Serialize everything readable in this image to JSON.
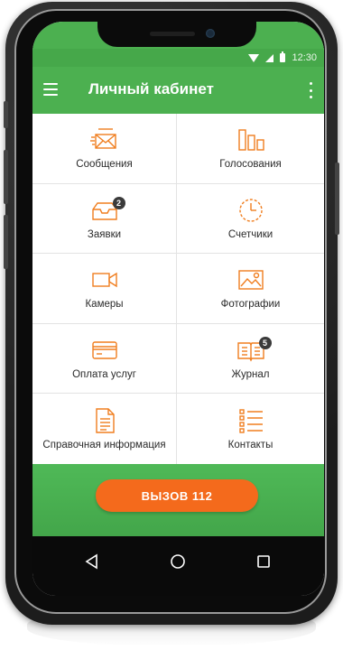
{
  "status_bar": {
    "time": "12:30"
  },
  "app_bar": {
    "title": "Личный кабинет"
  },
  "tiles": [
    {
      "label": "Сообщения",
      "icon": "envelope-icon"
    },
    {
      "label": "Голосования",
      "icon": "bar-chart-icon"
    },
    {
      "label": "Заявки",
      "icon": "inbox-tray-icon",
      "badge": "2"
    },
    {
      "label": "Счетчики",
      "icon": "meter-clock-icon"
    },
    {
      "label": "Камеры",
      "icon": "video-camera-icon"
    },
    {
      "label": "Фотографии",
      "icon": "photo-icon"
    },
    {
      "label": "Оплата услуг",
      "icon": "credit-card-icon"
    },
    {
      "label": "Журнал",
      "icon": "book-icon",
      "badge": "5"
    },
    {
      "label": "Справочная информация",
      "icon": "document-icon"
    },
    {
      "label": "Контакты",
      "icon": "list-icon"
    }
  ],
  "call_button": {
    "label": "ВЫЗОВ 112"
  },
  "colors": {
    "accent_green": "#4cb050",
    "icon_orange": "#f07e1f",
    "call_orange": "#f46a1c",
    "badge": "#3a3a3a"
  }
}
